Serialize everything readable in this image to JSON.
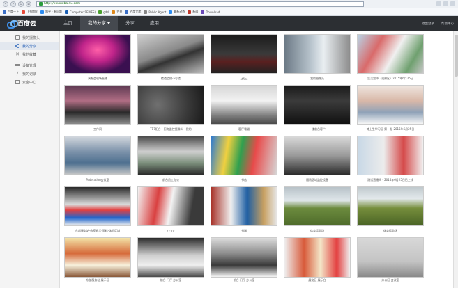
{
  "browser": {
    "url": "http://xxxxx.baidu.com",
    "bookmarks": [
      "百度一下",
      "飞书审批",
      "知乎 - 有问题",
      "Computer(SERIES)",
      "gdsl",
      "芒果",
      "百度文库",
      "Public Agent",
      "最新动态",
      "新闻",
      "Download"
    ]
  },
  "app": {
    "logo": "百度云",
    "nav": [
      {
        "label": "主页",
        "active": false
      },
      {
        "label": "我的分享",
        "active": true
      },
      {
        "label": "分享",
        "active": false
      },
      {
        "label": "应用",
        "active": false
      }
    ],
    "right_links": [
      "退出登录",
      "帮助中心"
    ]
  },
  "sidebar": {
    "items": [
      {
        "label": "我的摄像头",
        "icon": "person-icon",
        "active": false
      },
      {
        "label": "我的分享",
        "icon": "share-icon",
        "active": true
      },
      {
        "label": "我的收藏",
        "icon": "cross-icon",
        "active": false
      },
      {
        "label": "设备管理",
        "icon": "bars-icon",
        "active": false
      },
      {
        "label": "我的记录",
        "icon": "pen-icon",
        "active": false
      },
      {
        "label": "安全中心",
        "icon": "doc-icon",
        "active": false
      }
    ]
  },
  "cameras": [
    {
      "caption": "演唱会现场直播",
      "scene": "stage"
    },
    {
      "caption": "楼道监控-5号楼",
      "scene": "ceiling"
    },
    {
      "caption": "office",
      "scene": "desk"
    },
    {
      "caption": "我的摄像头",
      "scene": "window"
    },
    {
      "caption": "生活超市（观察区）2015年6月25日",
      "scene": "store"
    },
    {
      "caption": "工作间",
      "scene": "lab"
    },
    {
      "caption": "T17阳台 - 厨房监控摄像头 - 我的",
      "scene": "wall"
    },
    {
      "caption": "客厅看猫",
      "scene": "room"
    },
    {
      "caption": "一楼前台客户",
      "scene": "dark"
    },
    {
      "caption": "博士生学习区-第一批 2015年6月25日",
      "scene": "people"
    },
    {
      "caption": "Federation会议室",
      "scene": "meeting"
    },
    {
      "caption": "前台员工办公",
      "scene": "office2"
    },
    {
      "caption": "书店",
      "scene": "books"
    },
    {
      "caption": "通讯区域监控设备",
      "scene": "corridor"
    },
    {
      "caption": "测试直播间 - 2015年6月25日已上线",
      "scene": "stand"
    },
    {
      "caption": "东部服务站-教室教学-资料-体验区域",
      "scene": "classroom"
    },
    {
      "caption": "CCTV",
      "scene": "cctv"
    },
    {
      "caption": "书城",
      "scene": "shelves"
    },
    {
      "caption": "体育运动场",
      "scene": "field"
    },
    {
      "caption": "体育运动场",
      "scene": "field2"
    },
    {
      "caption": "东部服务站 展示区",
      "scene": "board"
    },
    {
      "caption": "前台 门厅 办公室",
      "scene": "lobby"
    },
    {
      "caption": "前台 门厅 办公室",
      "scene": "hall"
    },
    {
      "caption": "展览区 展示台",
      "scene": "poster"
    },
    {
      "caption": "办公区 会议室",
      "scene": "fog"
    }
  ]
}
